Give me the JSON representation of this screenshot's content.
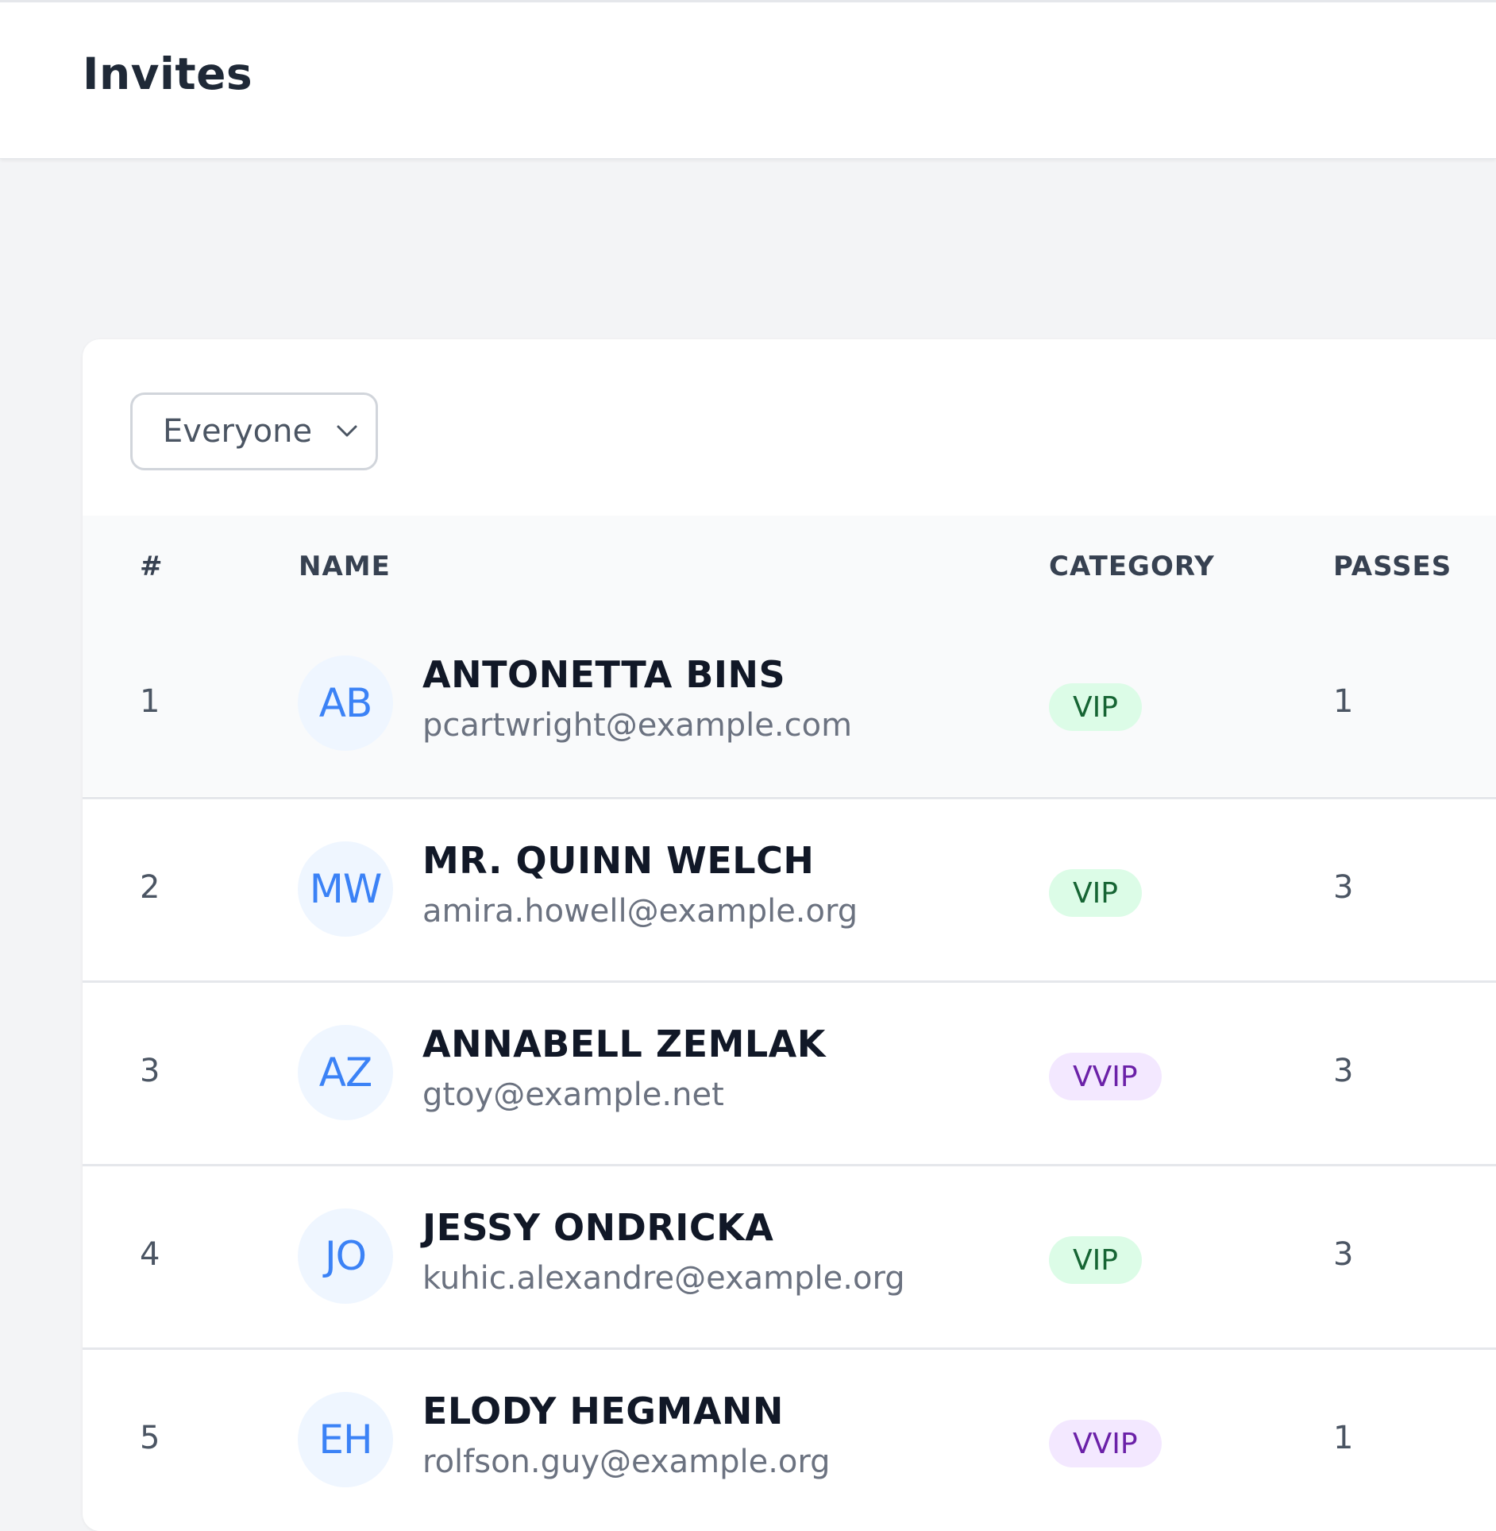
{
  "header": {
    "title": "Invites"
  },
  "filter": {
    "selected": "Everyone"
  },
  "table": {
    "columns": {
      "num": "#",
      "name": "NAME",
      "category": "CATEGORY",
      "passes": "PASSES"
    },
    "rows": [
      {
        "num": "1",
        "initials": "AB",
        "name": "ANTONETTA BINS",
        "email": "pcartwright@example.com",
        "category": "VIP",
        "passes": "1"
      },
      {
        "num": "2",
        "initials": "MW",
        "name": "MR. QUINN WELCH",
        "email": "amira.howell@example.org",
        "category": "VIP",
        "passes": "3"
      },
      {
        "num": "3",
        "initials": "AZ",
        "name": "ANNABELL ZEMLAK",
        "email": "gtoy@example.net",
        "category": "VVIP",
        "passes": "3"
      },
      {
        "num": "4",
        "initials": "JO",
        "name": "JESSY ONDRICKA",
        "email": "kuhic.alexandre@example.org",
        "category": "VIP",
        "passes": "3"
      },
      {
        "num": "5",
        "initials": "EH",
        "name": "ELODY HEGMANN",
        "email": "rolfson.guy@example.org",
        "category": "VVIP",
        "passes": "1"
      }
    ]
  },
  "colors": {
    "vip_bg": "#dcfce7",
    "vip_text": "#166534",
    "vvip_bg": "#f3e8ff",
    "vvip_text": "#6b21a8",
    "avatar_bg": "#eff6ff",
    "avatar_text": "#3b82f6"
  },
  "icons": {
    "filter_chevron": "chevron-down-icon"
  }
}
